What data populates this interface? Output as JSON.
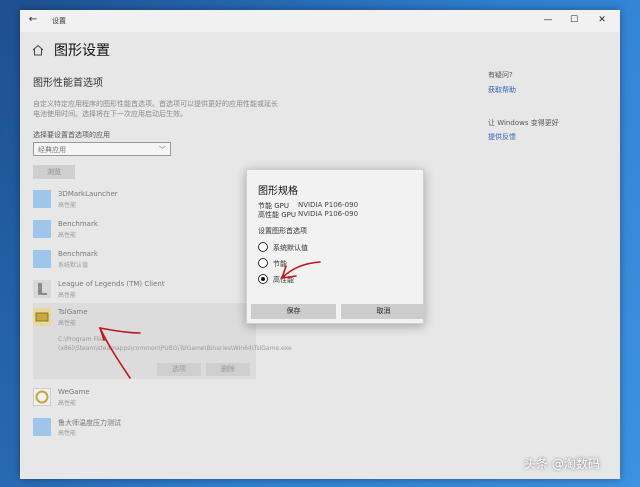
{
  "window": {
    "title": "设置",
    "back_icon": "back-arrow-icon",
    "minimize": "—",
    "maximize": "☐",
    "close": "✕"
  },
  "page": {
    "title": "图形设置",
    "home_icon": "home-icon"
  },
  "section": {
    "title": "图形性能首选项",
    "description": "自定义特定应用程序的图形性能首选项。首选项可以提供更好的应用性能或延长电池使用时间。选择将在下一次应用启动后生效。",
    "choose_label": "选择要设置首选项的应用",
    "app_type": "经典应用",
    "browse": "浏览"
  },
  "apps": [
    {
      "name": "3DMarkLauncher",
      "status": "高性能"
    },
    {
      "name": "Benchmark",
      "status": "高性能"
    },
    {
      "name": "Benchmark",
      "status": "系统默认值"
    },
    {
      "name": "League of Legends (TM) Client",
      "status": "高性能"
    },
    {
      "name": "TslGame",
      "status": "高性能",
      "path": "C:\\Program Files (x86)\\Steam\\steamapps\\common\\PUBG\\TslGame\\Binaries\\Win64\\TslGame.exe",
      "options": "选项",
      "delete": "删除"
    },
    {
      "name": "WeGame",
      "status": "高性能"
    },
    {
      "name": "鲁大师温度压力测试",
      "status": "高性能"
    }
  ],
  "side": {
    "q1": "有疑问?",
    "l1": "获取帮助",
    "q2": "让 Windows 变得更好",
    "l2": "提供反馈"
  },
  "dialog": {
    "title": "图形规格",
    "power_label": "节能 GPU",
    "power_value": "NVIDIA P106-090",
    "perf_label": "高性能 GPU",
    "perf_value": "NVIDIA P106-090",
    "pref_label": "设置图形首选项",
    "options": [
      "系统默认值",
      "节能",
      "高性能"
    ],
    "selected": "高性能",
    "save": "保存",
    "cancel": "取消"
  },
  "watermark": "头条 @淘数码",
  "colors": {
    "accent": "#2f63b5",
    "annotation": "#c0161b",
    "app_icon": "#9ec6ea"
  }
}
